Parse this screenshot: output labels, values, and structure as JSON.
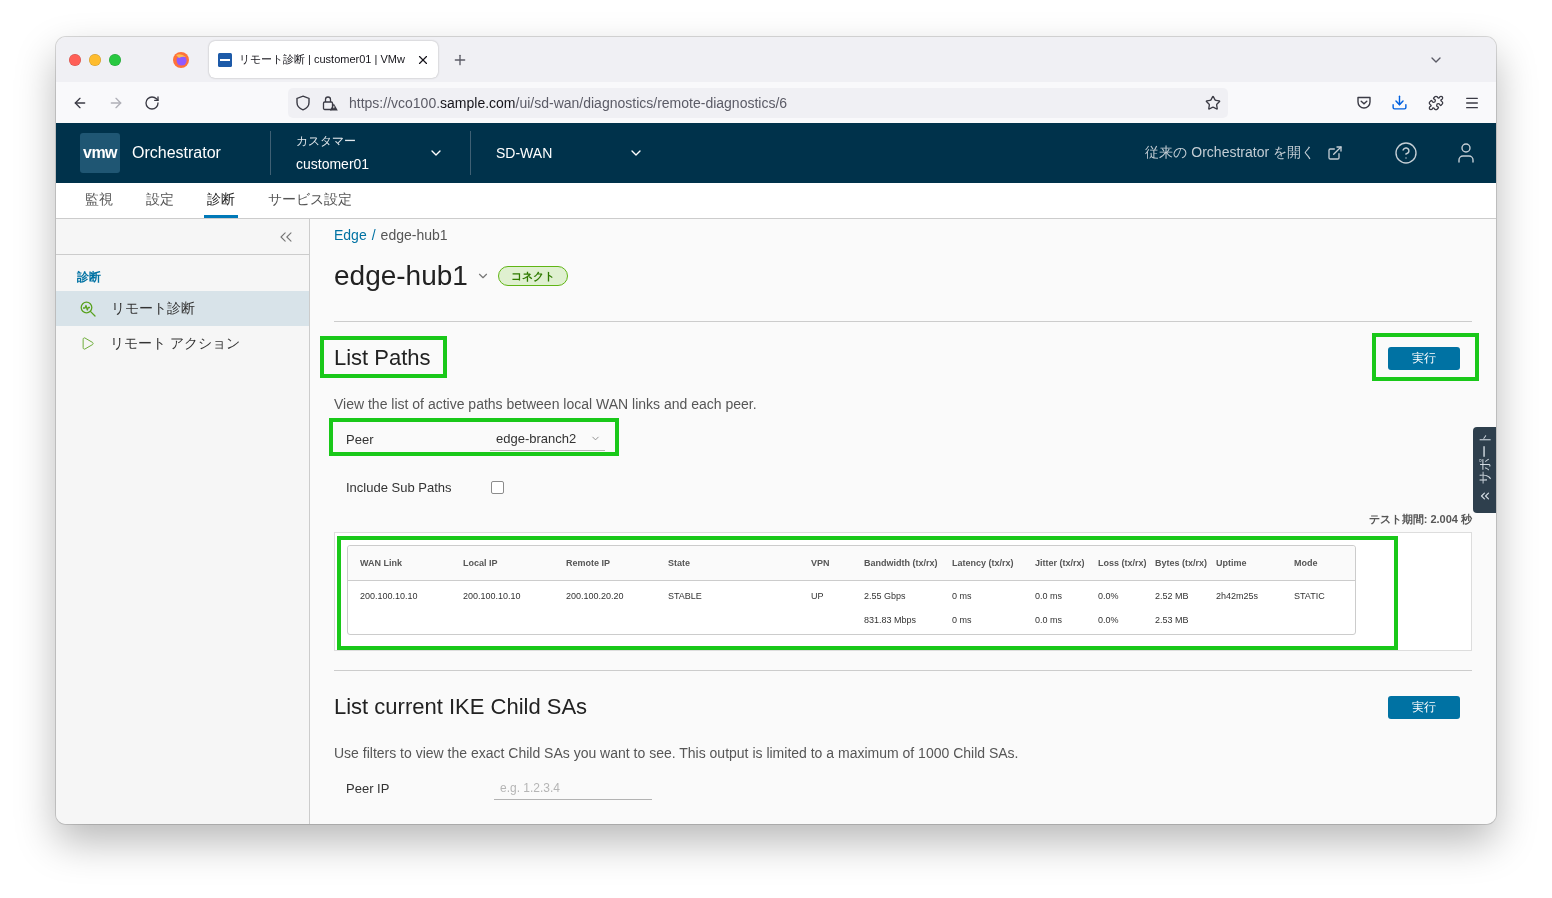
{
  "browser": {
    "tab": {
      "title": "リモート診断 | customer01 | VMw"
    },
    "url": {
      "prefix": "https://vco100.",
      "domain": "sample.com",
      "path": "/ui/sd-wan/diagnostics/remote-diagnostics/6"
    }
  },
  "header": {
    "logo": "vmw",
    "product": "Orchestrator",
    "customer": {
      "label": "カスタマー",
      "value": "customer01"
    },
    "service": {
      "value": "SD-WAN"
    },
    "legacy_link": "従来の Orchestrator を開く"
  },
  "nav_tabs": [
    {
      "label": "監視",
      "selected": false
    },
    {
      "label": "設定",
      "selected": false
    },
    {
      "label": "診断",
      "selected": true
    },
    {
      "label": "サービス設定",
      "selected": false
    }
  ],
  "sidebar": {
    "section": "診断",
    "items": [
      {
        "label": "リモート診断",
        "selected": true
      },
      {
        "label": "リモート アクション",
        "selected": false
      }
    ]
  },
  "breadcrumb": {
    "link": "Edge",
    "separator": "/",
    "current": "edge-hub1"
  },
  "edge": {
    "name": "edge-hub1",
    "status": "コネクト"
  },
  "sections": [
    {
      "title": "List Paths",
      "title_highlighted": true,
      "run_button": {
        "label": "実行",
        "highlighted": true
      },
      "description": "View the list of active paths between local WAN links and each peer.",
      "fields": [
        {
          "kind": "select",
          "label": "Peer",
          "value": "edge-branch2",
          "highlighted": true
        },
        {
          "kind": "checkbox",
          "label": "Include Sub Paths",
          "checked": false
        }
      ],
      "test_duration": "テスト期間: 2.004 秒",
      "results": {
        "highlighted": true,
        "columns": [
          "WAN Link",
          "Local IP",
          "Remote IP",
          "State",
          "VPN",
          "Bandwidth (tx/rx)",
          "Latency (tx/rx)",
          "Jitter (tx/rx)",
          "Loss (tx/rx)",
          "Bytes (tx/rx)",
          "Uptime",
          "Mode"
        ],
        "rows": [
          {
            "cells": [
              [
                "200.100.10.10"
              ],
              [
                "200.100.10.10"
              ],
              [
                "200.100.20.20"
              ],
              [
                "STABLE"
              ],
              [
                "UP"
              ],
              [
                "2.55 Gbps",
                "831.83 Mbps"
              ],
              [
                "0 ms",
                "0 ms"
              ],
              [
                "0.0 ms",
                "0.0 ms"
              ],
              [
                "0.0%",
                "0.0%"
              ],
              [
                "2.52 MB",
                "2.53 MB"
              ],
              [
                "2h42m25s"
              ],
              [
                "STATIC"
              ]
            ]
          }
        ]
      }
    },
    {
      "title": "List current IKE Child SAs",
      "run_button": {
        "label": "実行"
      },
      "description": "Use filters to view the exact Child SAs you want to see. This output is limited to a maximum of 1000 Child SAs.",
      "fields": [
        {
          "kind": "input",
          "label": "Peer IP",
          "placeholder": "e.g. 1.2.3.4"
        }
      ]
    }
  ],
  "support_tab": {
    "label": "サポート"
  }
}
